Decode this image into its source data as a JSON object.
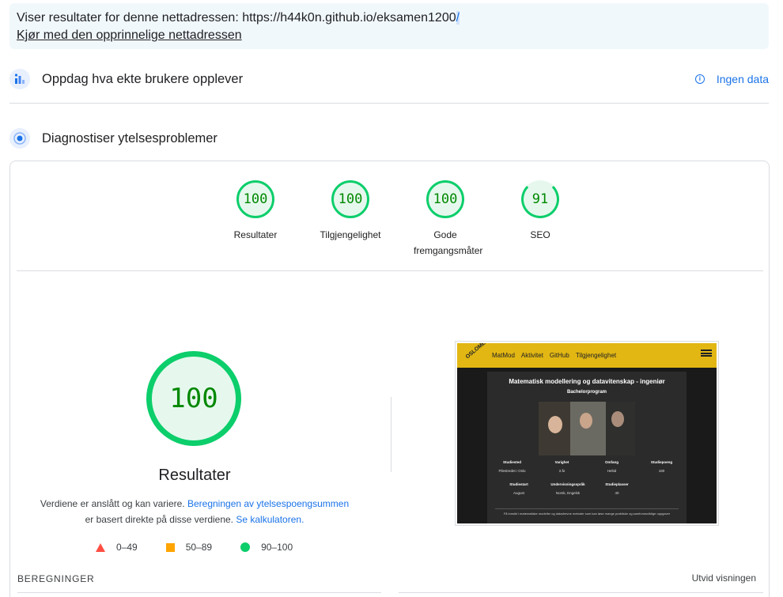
{
  "banner": {
    "prefix": "Viser resultater for denne nettadressen: https://h44k0n.github.io/eksamen1200",
    "slash": "/",
    "original_link": "Kjør med den opprinnelige nettadressen"
  },
  "field_data": {
    "title": "Oppdag hva ekte brukere opplever",
    "no_data_label": "Ingen data",
    "icon": "people-chart-icon"
  },
  "diagnose": {
    "title": "Diagnostiser ytelsesproblemer",
    "icon": "lighthouse-icon"
  },
  "scores": [
    {
      "value": "100",
      "label": "Resultater"
    },
    {
      "value": "100",
      "label": "Tilgjengelighet"
    },
    {
      "value": "100",
      "label": "Gode fremgangsmåter"
    },
    {
      "value": "91",
      "label": "SEO"
    }
  ],
  "performance": {
    "score": "100",
    "title": "Resultater",
    "note_text_1": "Verdiene er anslått og kan variere.",
    "note_link_1": "Beregningen av ytelsespoengsummen",
    "note_text_2": "er basert direkte på disse verdiene.",
    "note_link_2": "Se kalkulatoren."
  },
  "legend": [
    {
      "range": "0–49",
      "color": "#ff4e42",
      "shape": "triangle"
    },
    {
      "range": "50–89",
      "color": "#ffa400",
      "shape": "square"
    },
    {
      "range": "90–100",
      "color": "#0cce6b",
      "shape": "circle"
    }
  ],
  "screenshot": {
    "logo": "OSLOMET",
    "nav": [
      "MatMod",
      "Aktivitet",
      "GitHub",
      "Tilgjengelighet"
    ],
    "heading": "Matematisk modellering og datavitenskap - ingeniør",
    "subheading": "Bachelorprogram",
    "row1": [
      {
        "k": "Studiested",
        "v": "Pilestredet i Oslo"
      },
      {
        "k": "Varighet",
        "v": "3 år"
      },
      {
        "k": "Omfang",
        "v": "Heltid"
      },
      {
        "k": "Studiepoeng",
        "v": "180"
      }
    ],
    "row2": [
      {
        "k": "Studiestart",
        "v": "August"
      },
      {
        "k": "Undervisningsspråk",
        "v": "Norsk, Engelsk"
      },
      {
        "k": "Studieplasser",
        "v": "40"
      }
    ],
    "footer": "Få innsikt i matematiske modeller og datadrevne metoder som kan løse mange praktiske og samfunnsviktige oppgaver"
  },
  "metrics": {
    "heading": "BEREGNINGER",
    "expand": "Utvid visningen"
  },
  "colors": {
    "pass": "#0cce6b",
    "pass_text": "#008800",
    "link": "#1a73e8"
  }
}
